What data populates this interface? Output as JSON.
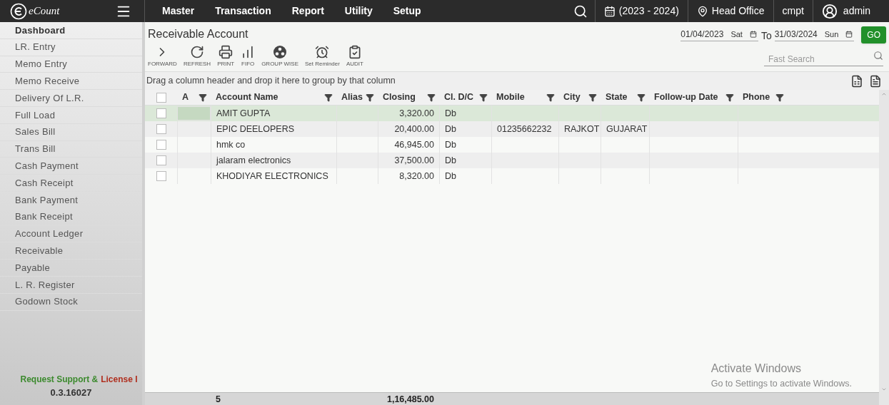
{
  "header": {
    "logo": "eCount",
    "menu": [
      "Master",
      "Transaction",
      "Report",
      "Utility",
      "Setup"
    ],
    "year": "(2023 - 2024)",
    "branch": "Head Office",
    "company": "cmpt",
    "user": "admin"
  },
  "sidebar": {
    "items": [
      {
        "label": "Dashboard",
        "selected": true
      },
      {
        "label": "LR. Entry",
        "selected": false
      },
      {
        "label": "Memo Entry",
        "selected": false
      },
      {
        "label": "Memo Receive",
        "selected": false
      },
      {
        "label": "Delivery Of L.R.",
        "selected": false
      },
      {
        "label": "Full Load",
        "selected": false
      },
      {
        "label": "Sales Bill",
        "selected": false
      },
      {
        "label": "Trans Bill",
        "selected": false
      },
      {
        "label": "Cash Payment",
        "selected": false
      },
      {
        "label": "Cash Receipt",
        "selected": false
      },
      {
        "label": "Bank Payment",
        "selected": false
      },
      {
        "label": "Bank Receipt",
        "selected": false
      },
      {
        "label": "Account Ledger",
        "selected": false
      },
      {
        "label": "Receivable",
        "selected": false
      },
      {
        "label": "Payable",
        "selected": false
      },
      {
        "label": "L. R. Register",
        "selected": false
      },
      {
        "label": "Godown Stock",
        "selected": false
      }
    ],
    "support_link": "Request Support &",
    "license_link": "License I",
    "version": "0.3.16027"
  },
  "page": {
    "title": "Receivable Account",
    "from_date": "01/04/2023",
    "from_day": "Sat",
    "to_label": "To",
    "to_date": "31/03/2024",
    "to_day": "Sun",
    "go_button": "GO",
    "toolbar": [
      {
        "kind": "forward",
        "label": "FORWARD"
      },
      {
        "kind": "refresh",
        "label": "REFRESH"
      },
      {
        "kind": "print",
        "label": "PRINT"
      },
      {
        "kind": "fifo",
        "label": "FIFO"
      },
      {
        "kind": "group",
        "label": "GROUP WISE"
      },
      {
        "kind": "reminder",
        "label": "Set Reminder"
      },
      {
        "kind": "audit",
        "label": "AUDIT"
      }
    ],
    "search": {
      "placeholder": "Fast Search"
    },
    "group_hint": "Drag a column header and drop it here to group by that column"
  },
  "table": {
    "select_all": false,
    "columns": [
      {
        "label": "A",
        "kind": "text"
      },
      {
        "label": "Account Name",
        "kind": "text"
      },
      {
        "label": "Alias",
        "kind": "text"
      },
      {
        "label": "Closing",
        "kind": "amount"
      },
      {
        "label": "Cl. D/C",
        "kind": "text"
      },
      {
        "label": "Mobile",
        "kind": "text"
      },
      {
        "label": "City",
        "kind": "text"
      },
      {
        "label": "State",
        "kind": "text"
      },
      {
        "label": "Follow-up Date",
        "kind": "text"
      },
      {
        "label": "Phone",
        "kind": "text"
      }
    ],
    "rows": [
      {
        "selected": true,
        "checked": false,
        "cells": [
          "",
          "AMIT GUPTA",
          "",
          "3,320.00",
          "Db",
          "",
          "",
          "",
          "",
          ""
        ]
      },
      {
        "selected": false,
        "checked": false,
        "cells": [
          "",
          "EPIC DEELOPERS",
          "",
          "20,400.00",
          "Db",
          "01235662232",
          "RAJKOT",
          "GUJARAT",
          "",
          ""
        ]
      },
      {
        "selected": false,
        "checked": false,
        "cells": [
          "",
          "hmk co",
          "",
          "46,945.00",
          "Db",
          "",
          "",
          "",
          "",
          ""
        ]
      },
      {
        "selected": false,
        "checked": false,
        "cells": [
          "",
          "jalaram electronics",
          "",
          "37,500.00",
          "Db",
          "",
          "",
          "",
          "",
          ""
        ]
      },
      {
        "selected": false,
        "checked": false,
        "cells": [
          "",
          "KHODIYAR ELECTRONICS",
          "",
          "8,320.00",
          "Db",
          "",
          "",
          "",
          "",
          ""
        ]
      }
    ],
    "footer": {
      "count": "5",
      "total": "1,16,485.00"
    }
  },
  "os_overlay": {
    "title": "Activate Windows",
    "subtitle": "Go to Settings to activate Windows."
  }
}
